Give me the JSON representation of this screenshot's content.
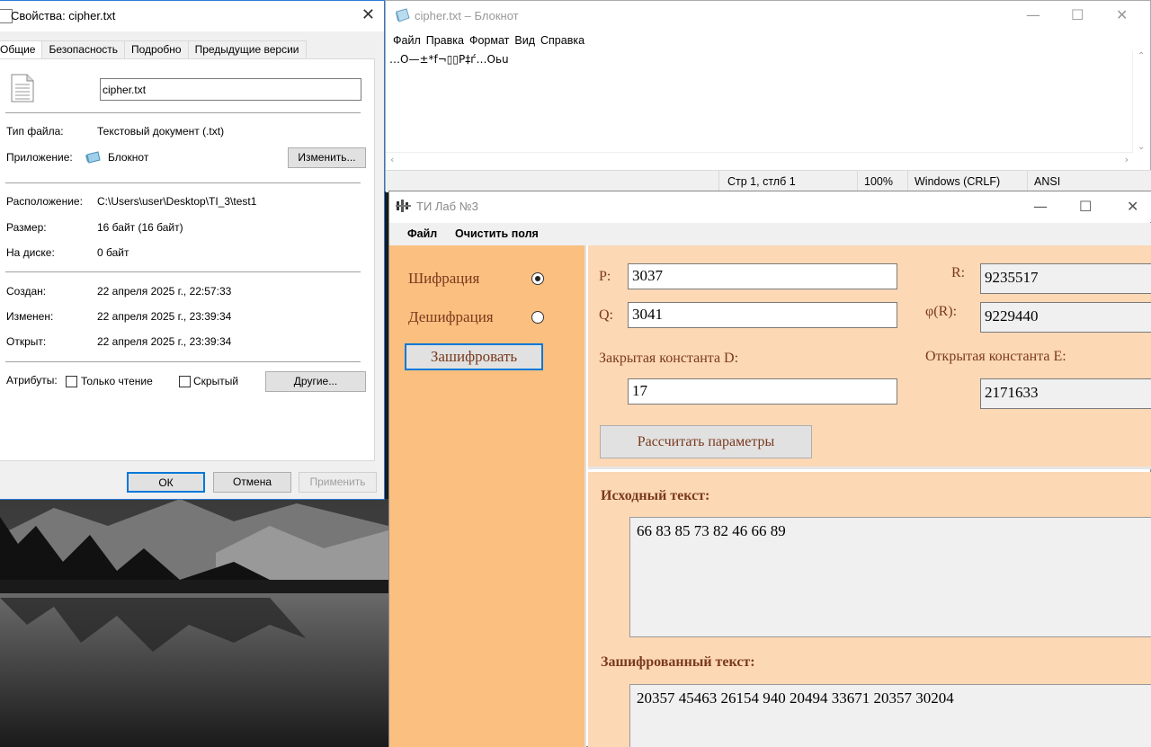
{
  "properties": {
    "title": "Свойства: cipher.txt",
    "tabs": [
      "Общие",
      "Безопасность",
      "Подробно",
      "Предыдущие версии"
    ],
    "filename": "cipher.txt",
    "rows": {
      "type_label": "Тип файла:",
      "type_value": "Текстовый документ (.txt)",
      "app_label": "Приложение:",
      "app_value": "Блокнот",
      "change_button": "Изменить...",
      "location_label": "Расположение:",
      "location_value": "C:\\Users\\user\\Desktop\\TI_3\\test1",
      "size_label": "Размер:",
      "size_value": "16 байт (16 байт)",
      "ondisk_label": "На диске:",
      "ondisk_value": "0 байт",
      "created_label": "Создан:",
      "created_value": "22 апреля 2025 г., 22:57:33",
      "modified_label": "Изменен:",
      "modified_value": "22 апреля 2025 г., 23:39:34",
      "opened_label": "Открыт:",
      "opened_value": "22 апреля 2025 г., 23:39:34"
    },
    "attributes_label": "Атрибуты:",
    "readonly_label": "Только чтение",
    "hidden_label": "Скрытый",
    "other_button": "Другие...",
    "ok_button": "ОК",
    "cancel_button": "Отмена",
    "apply_button": "Применить"
  },
  "notepad": {
    "title": "cipher.txt – Блокнот",
    "menu": [
      "Файл",
      "Правка",
      "Формат",
      "Вид",
      "Справка"
    ],
    "content": "…O—±*f¬▯▯Р‡ѓ…Оьu",
    "status": {
      "position": "Стр 1, стлб 1",
      "zoom": "100%",
      "line_ending": "Windows (CRLF)",
      "encoding": "ANSI"
    }
  },
  "app": {
    "title": "ТИ Лаб №3",
    "menu": [
      "Файл",
      "Очистить поля"
    ],
    "mode_encrypt": "Шифрация",
    "mode_decrypt": "Дешифрация",
    "mode_selected": "encrypt",
    "action_button": "Зашифровать",
    "p_label": "P:",
    "p_value": "3037",
    "q_label": "Q:",
    "q_value": "3041",
    "r_label": "R:",
    "r_value": "9235517",
    "phi_label": "φ(R):",
    "phi_value": "9229440",
    "d_label": "Закрытая константа D:",
    "d_value": "17",
    "e_label": "Открытая константа E:",
    "e_value": "2171633",
    "calc_button": "Рассчитать параметры",
    "source_label": "Исходный текст:",
    "source_text": "66 83 85 73 82 46 66 89",
    "cipher_label": "Зашифрованный текст:",
    "cipher_text": "20357 45463 26154 940 20494 33671 20357 30204"
  }
}
